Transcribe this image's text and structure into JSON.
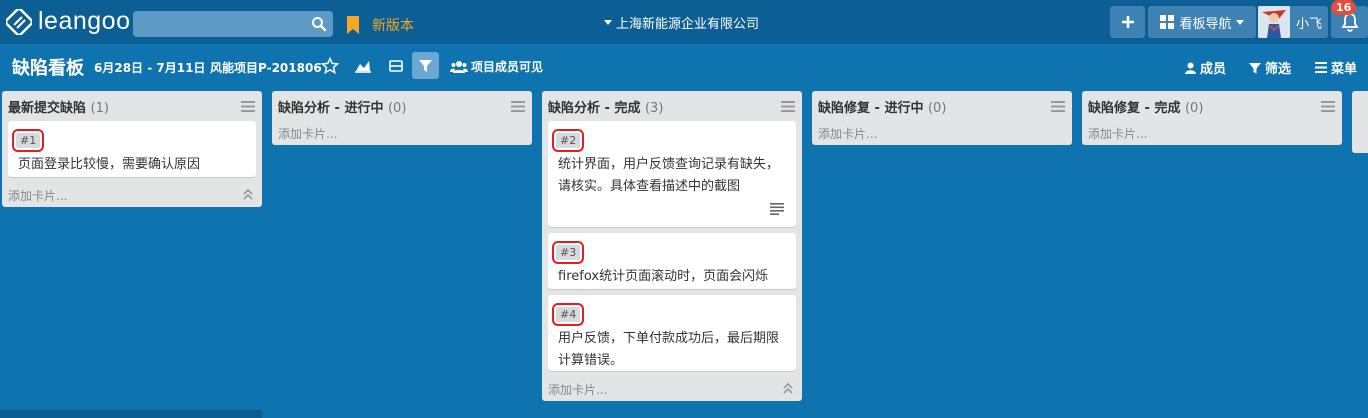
{
  "nav": {
    "logo": "leangoo",
    "search_placeholder": "",
    "new_version": "新版本",
    "organization": "上海新能源企业有限公司",
    "board_nav": "看板导航",
    "user_name": "小飞",
    "notification_count": "16"
  },
  "board": {
    "title": "缺陷看板",
    "date_range": "6月28日 - 7月11日",
    "project": "风能项目P-201806",
    "visibility": "项目成员可见",
    "members": "成员",
    "filter": "筛选",
    "menu": "菜单"
  },
  "lists": [
    {
      "title": "最新提交缺陷",
      "count": "(1)",
      "add_card": "添加卡片...",
      "cards": [
        {
          "tag": "#1",
          "text": "页面登录比较慢，需要确认原因"
        }
      ]
    },
    {
      "title": "缺陷分析 - 进行中",
      "count": "(0)",
      "add_card": "添加卡片..."
    },
    {
      "title": "缺陷分析 - 完成",
      "count": "(3)",
      "add_card": "添加卡片...",
      "cards": [
        {
          "tag": "#2",
          "text": "统计界面，用户反馈查询记录有缺失，请核实。具体查看描述中的截图"
        },
        {
          "tag": "#3",
          "text": "firefox统计页面滚动时，页面会闪烁"
        },
        {
          "tag": "#4",
          "text": "用户反馈，下单付款成功后，最后期限计算错误。"
        }
      ]
    },
    {
      "title": "缺陷修复 - 进行中",
      "count": "(0)",
      "add_card": "添加卡片..."
    },
    {
      "title": "缺陷修复 - 完成",
      "count": "(0)",
      "add_card": "添加卡片..."
    }
  ],
  "colors": {
    "board_bg": "#0f73b0",
    "topbar_bg": "#0c5f95",
    "accent_orange": "#f5a623",
    "highlight_red": "#e02020"
  }
}
